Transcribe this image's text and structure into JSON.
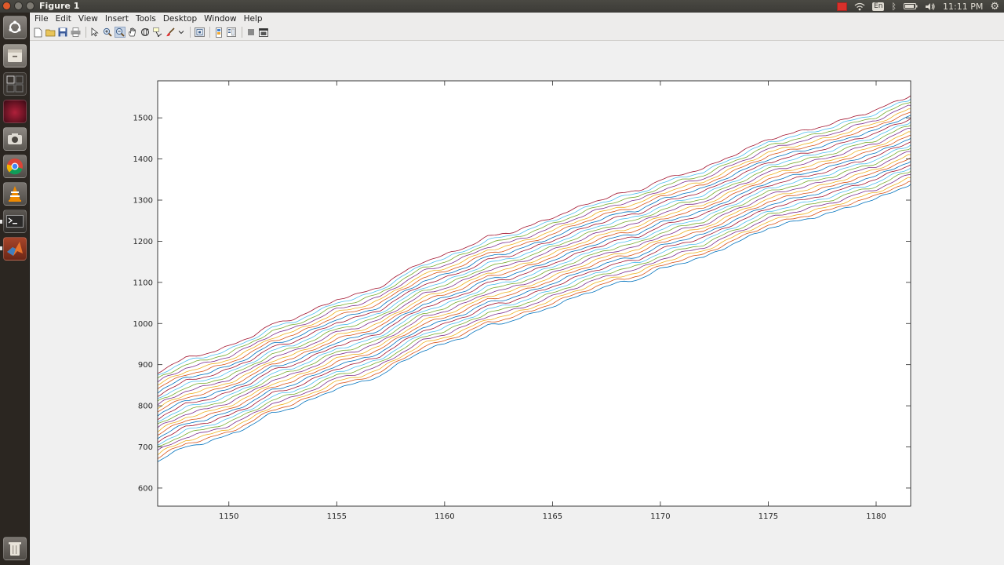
{
  "window": {
    "title": "Figure 1"
  },
  "top_panel": {
    "language": "En",
    "time": "11:11 PM",
    "indicators": [
      "record-icon",
      "wifi-icon",
      "keyboard-icon",
      "bluetooth-icon",
      "battery-icon",
      "volume-icon",
      "gear-icon"
    ]
  },
  "launcher": {
    "items": [
      "ubuntu-dash-icon",
      "file-manager-icon",
      "workspace-switcher-icon",
      "image-viewer-icon",
      "screenshot-icon",
      "chrome-icon",
      "vlc-icon",
      "terminal-icon",
      "matlab-icon",
      "trash-icon"
    ]
  },
  "menubar": {
    "items": [
      "File",
      "Edit",
      "View",
      "Insert",
      "Tools",
      "Desktop",
      "Window",
      "Help"
    ]
  },
  "toolbar": {
    "buttons": [
      "new-figure-icon",
      "open-file-icon",
      "save-icon",
      "print-icon",
      "select-arrow-icon",
      "zoom-in-icon",
      "zoom-out-icon",
      "pan-icon",
      "rotate-icon",
      "data-cursor-icon",
      "brush-icon",
      "link-plot-icon",
      "colorbar-icon",
      "legend-icon",
      "hide-plot-tools-icon",
      "show-plot-tools-icon"
    ],
    "active": "zoom-out-icon"
  },
  "colors": {
    "series": [
      "#0072bd",
      "#d95319",
      "#edb120",
      "#7e2f8e",
      "#77ac30",
      "#4dbeee",
      "#a2142f"
    ]
  },
  "chart_data": {
    "type": "line",
    "title": "",
    "xlabel": "",
    "ylabel": "",
    "xlim": [
      1146.7,
      1181.6
    ],
    "ylim": [
      556,
      1590
    ],
    "xticks": [
      1150,
      1155,
      1160,
      1165,
      1170,
      1175,
      1180
    ],
    "yticks": [
      600,
      700,
      800,
      900,
      1000,
      1100,
      1200,
      1300,
      1400,
      1500
    ],
    "grid": false,
    "legend": "none",
    "series_count": 28,
    "series_offset_step": 8,
    "base_series": {
      "x": [
        1146.7,
        1147.0,
        1148.0,
        1149.0,
        1150.0,
        1151.0,
        1152.0,
        1153.0,
        1154.0,
        1155.0,
        1156.0,
        1157.0,
        1158.0,
        1159.0,
        1160.0,
        1161.0,
        1162.0,
        1163.0,
        1164.0,
        1165.0,
        1166.0,
        1167.0,
        1168.0,
        1169.0,
        1170.0,
        1171.0,
        1172.0,
        1173.0,
        1174.0,
        1175.0,
        1176.0,
        1177.0,
        1178.0,
        1179.0,
        1180.0,
        1181.0,
        1181.6
      ],
      "y": [
        665,
        675,
        700,
        712,
        728,
        752,
        782,
        796,
        818,
        843,
        855,
        873,
        905,
        935,
        950,
        970,
        995,
        1005,
        1022,
        1042,
        1062,
        1082,
        1098,
        1108,
        1132,
        1148,
        1160,
        1185,
        1208,
        1232,
        1245,
        1257,
        1270,
        1288,
        1302,
        1326,
        1338
      ]
    }
  }
}
